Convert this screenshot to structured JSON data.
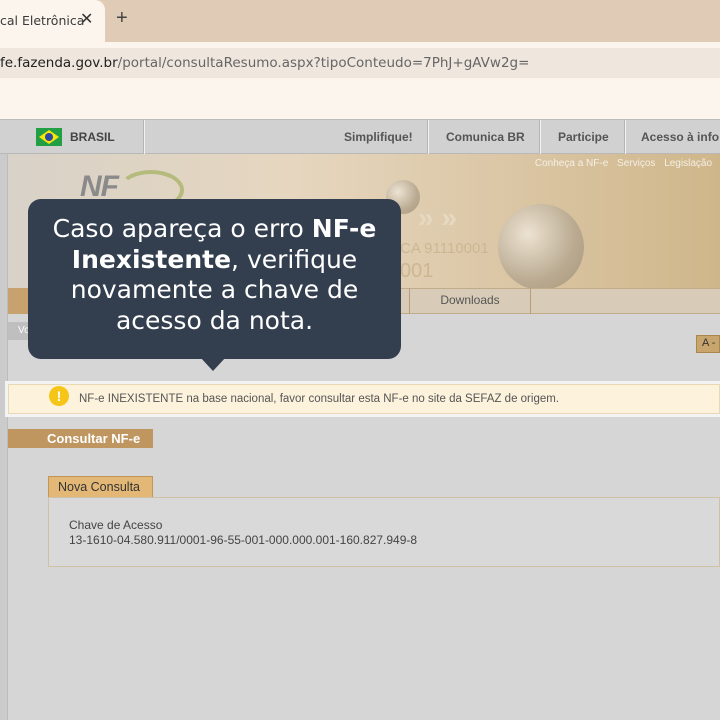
{
  "browser": {
    "tab_title": "cal Eletrônica",
    "close_glyph": "✕",
    "new_tab_glyph": "+",
    "url_host": "fe.fazenda.gov.br",
    "url_path": "/portal/consultaResumo.aspx?tipoConteudo=7PhJ+gAVw2g="
  },
  "govbar": {
    "country": "BRASIL",
    "links": [
      "Simplifique!",
      "Comunica BR",
      "Participe",
      "Acesso à info"
    ]
  },
  "banner": {
    "links": [
      "Conheça a NF-e",
      "Serviços",
      "Legislação"
    ],
    "logo_text": "NF",
    "faint_text_1": "CA  91110001",
    "faint_text_2": "001"
  },
  "nav": {
    "downloads_label": "Downloads",
    "vo_label": "Vo",
    "font_button": "A -"
  },
  "alert": {
    "icon": "!",
    "message": "NF-e INEXISTENTE na base nacional, favor consultar esta NF-e no site da SEFAZ de origem."
  },
  "consulta": {
    "section_title": "Consultar NF-e",
    "tab_label": "Nova Consulta",
    "chave_label": "Chave de Acesso",
    "chave_value": "13-1610-04.580.911/0001-96-55-001-000.000.001-160.827.949-8"
  },
  "tooltip": {
    "prefix": "Caso apareça o erro ",
    "bold_term": "NF-e Inexistente",
    "suffix": ", verifique novamente a chave de acesso da nota."
  },
  "colors": {
    "tooltip_bg": "#333e4e",
    "tab_bar": "#e0cbb7",
    "alert_bg": "#fdf3dd",
    "section_accent": "#bf9660"
  }
}
